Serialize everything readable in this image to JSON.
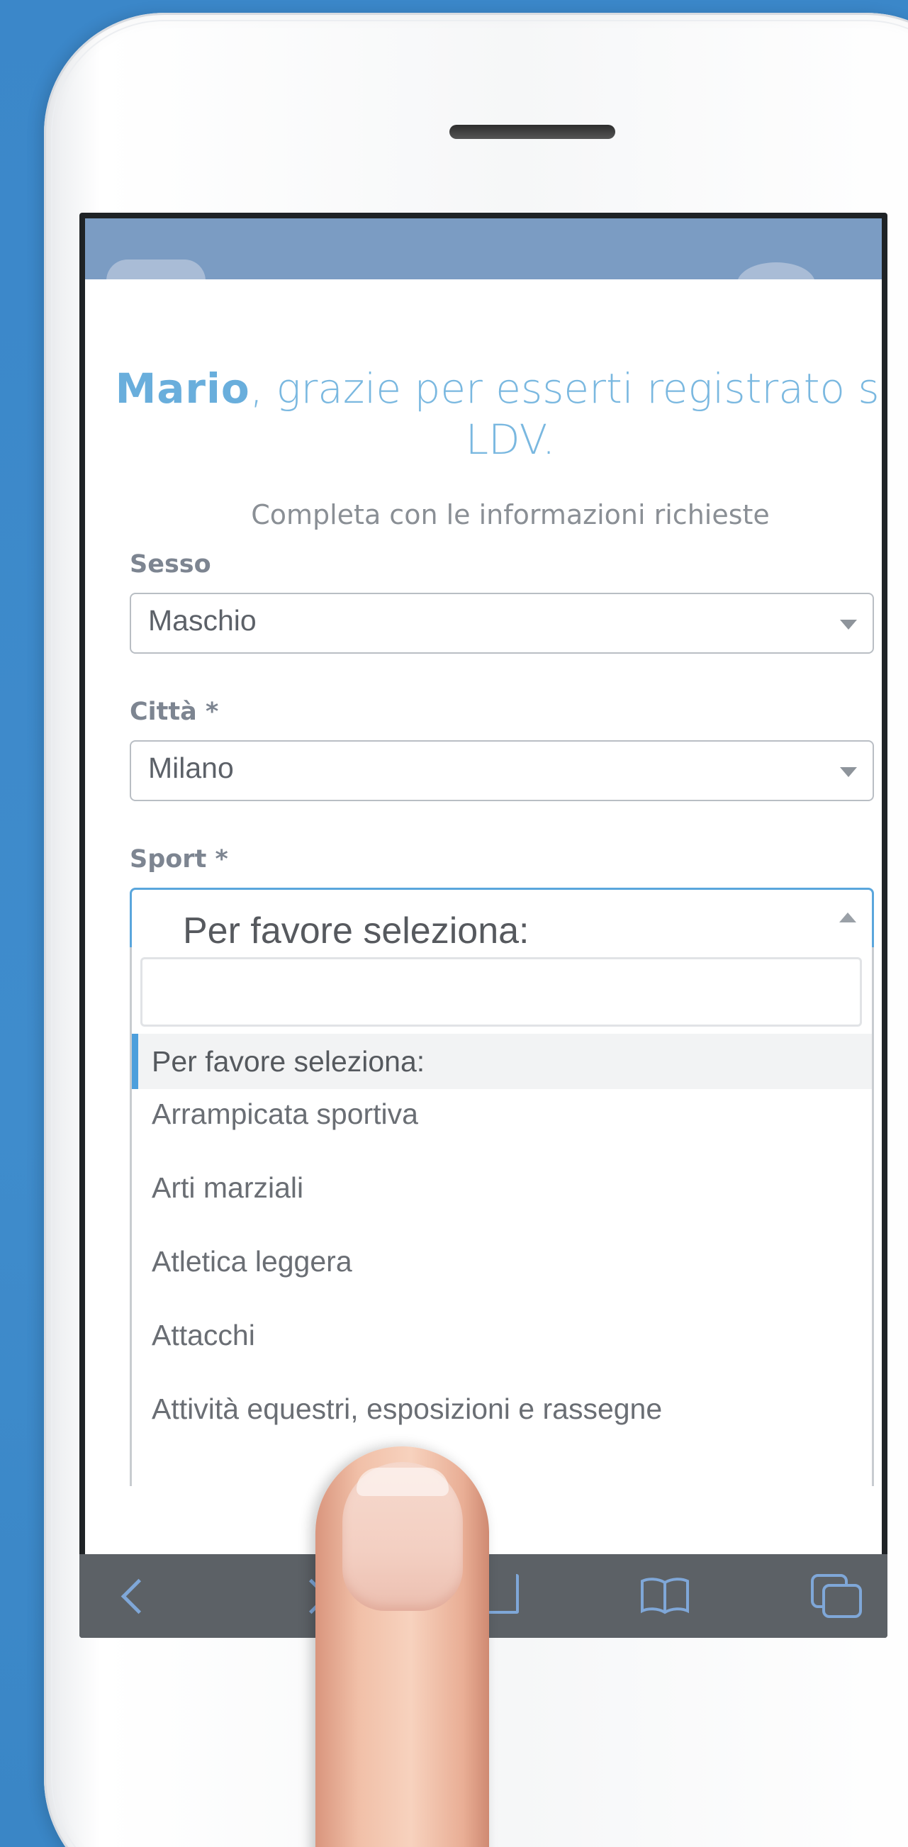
{
  "header": {
    "name": "Mario",
    "title_rest": ", grazie per esserti registrato su LDV.",
    "subtitle": "Completa con le informazioni richieste"
  },
  "form": {
    "sesso": {
      "label": "Sesso",
      "value": "Maschio"
    },
    "citta": {
      "label": "Città *",
      "value": "Milano"
    },
    "sport": {
      "label": "Sport *",
      "value": "Per favore seleziona:",
      "search_value": "",
      "options": [
        "Per favore seleziona:",
        "Arrampicata sportiva",
        "Arti marziali",
        "Atletica leggera",
        "Attacchi",
        "Attività equestri, esposizioni e rassegne"
      ],
      "selected_index": 0
    }
  },
  "colors": {
    "accent": "#5aa6dc",
    "title": "#7ab8e0",
    "background": "#3f8ccc"
  },
  "toolbar": {
    "icons": [
      "back-icon",
      "forward-icon",
      "share-icon",
      "bookmarks-icon",
      "tabs-icon"
    ]
  }
}
